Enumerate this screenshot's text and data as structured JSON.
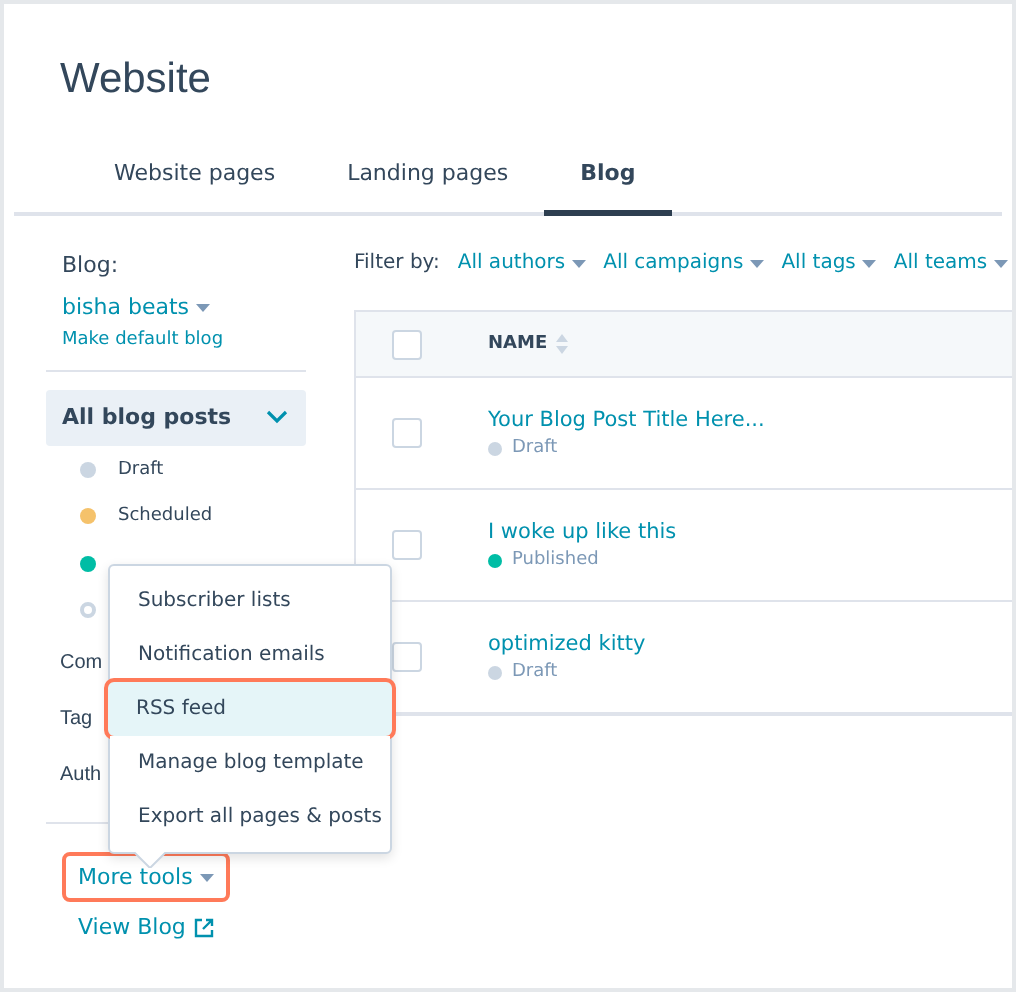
{
  "title": "Website",
  "tabs": [
    {
      "label": "Website pages",
      "selected": false
    },
    {
      "label": "Landing pages",
      "selected": false
    },
    {
      "label": "Blog",
      "selected": true
    }
  ],
  "sidebar": {
    "blog_label": "Blog:",
    "blog_name": "bisha beats",
    "make_default": "Make default blog",
    "section": {
      "label": "All blog posts",
      "expanded": true
    },
    "statuses": [
      {
        "label": "Draft",
        "color": "#cbd6e2",
        "kind": "filled"
      },
      {
        "label": "Scheduled",
        "color": "#f5c26b",
        "kind": "filled"
      },
      {
        "color": "#00bda5",
        "kind": "filled"
      },
      {
        "color": "#cbd6e2",
        "kind": "hollow"
      }
    ],
    "partial_labels": [
      "Com",
      "Tag",
      "Auth"
    ],
    "more_tools": {
      "label": "More tools",
      "highlighted": true
    },
    "view_blog": "View Blog"
  },
  "menu": [
    {
      "label": "Subscriber lists",
      "highlighted": false
    },
    {
      "label": "Notification emails",
      "highlighted": false
    },
    {
      "label": "RSS feed",
      "highlighted": true
    },
    {
      "label": "Manage blog template",
      "highlighted": false
    },
    {
      "label": "Export all pages & posts",
      "highlighted": false
    }
  ],
  "filters": {
    "label": "Filter by:",
    "options": [
      "All authors",
      "All campaigns",
      "All tags",
      "All teams"
    ]
  },
  "table": {
    "all_checked": false,
    "column": "NAME",
    "rows": [
      {
        "title": "Your Blog Post Title Here...",
        "status": "Draft",
        "color": "#cbd6e2",
        "checked": false
      },
      {
        "title": "I woke up like this",
        "status": "Published",
        "color": "#00bda5",
        "checked": false
      },
      {
        "title": "optimized kitty",
        "status": "Draft",
        "color": "#cbd6e2",
        "checked": false
      }
    ]
  }
}
